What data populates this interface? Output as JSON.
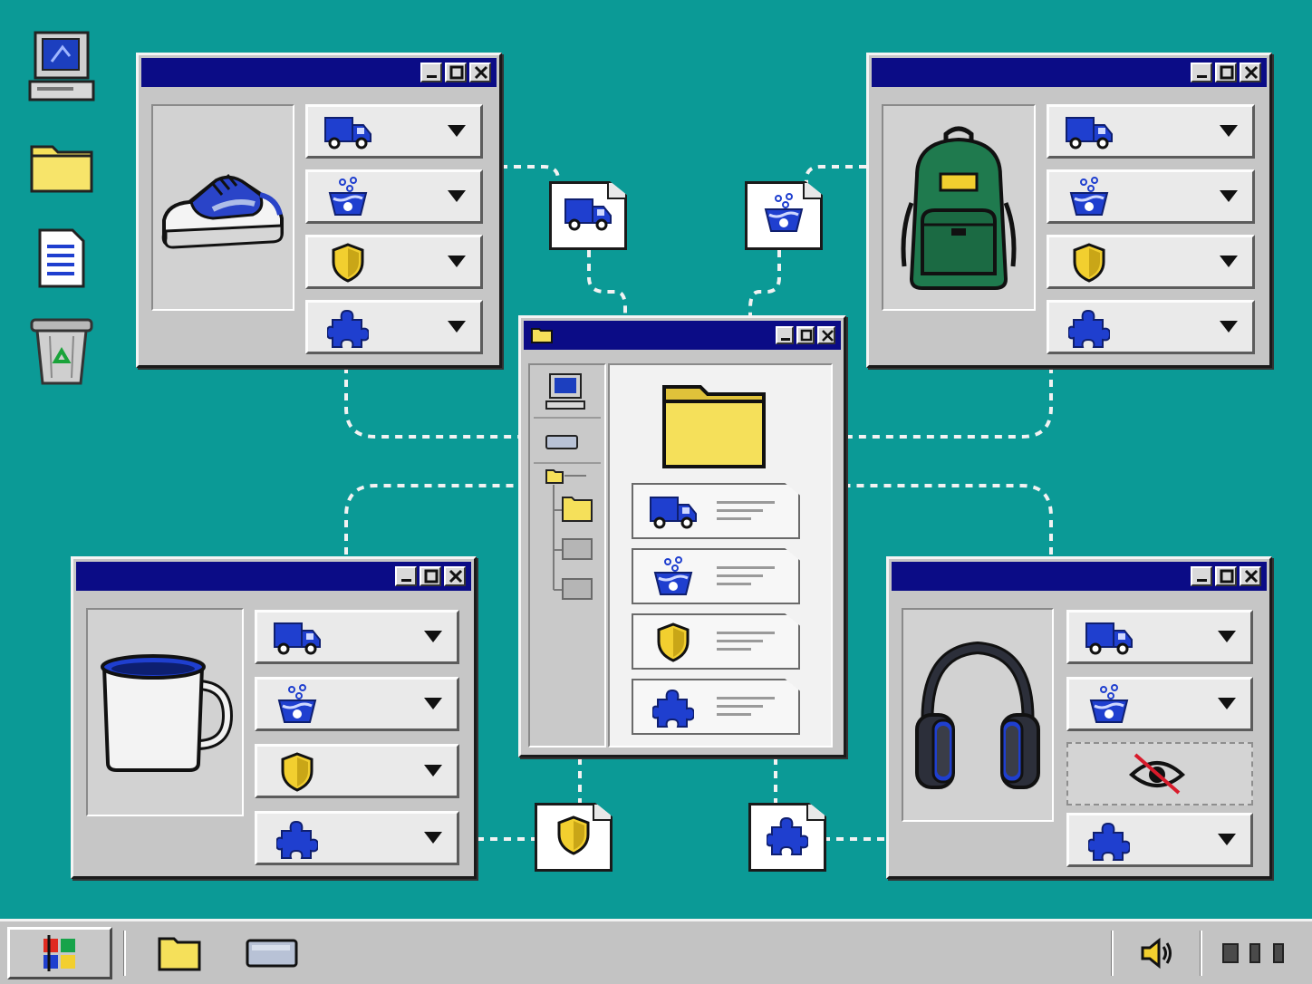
{
  "colors": {
    "desktop": "#0b9a96",
    "titlebar": "#0b0c86",
    "window_face": "#c6c6c6",
    "icon_blue": "#1f3fcf",
    "folder_yellow": "#f5e05a",
    "shield_yellow": "#f2cf2f"
  },
  "desktop_icons": [
    "computer-icon",
    "folder-icon",
    "document-icon",
    "recycle-bin-icon"
  ],
  "option_icons": [
    "delivery-truck-icon",
    "washing-basin-icon",
    "shield-icon",
    "puzzle-piece-icon"
  ],
  "windows": [
    {
      "id": "sneaker-window",
      "product_icon": "sneaker-icon",
      "dropdowns": [
        "delivery-truck-icon",
        "washing-basin-icon",
        "shield-icon",
        "puzzle-piece-icon"
      ]
    },
    {
      "id": "backpack-window",
      "product_icon": "backpack-icon",
      "dropdowns": [
        "delivery-truck-icon",
        "washing-basin-icon",
        "shield-icon",
        "puzzle-piece-icon"
      ]
    },
    {
      "id": "mug-window",
      "product_icon": "mug-icon",
      "dropdowns": [
        "delivery-truck-icon",
        "washing-basin-icon",
        "shield-icon",
        "puzzle-piece-icon"
      ]
    },
    {
      "id": "headphones-window",
      "product_icon": "headphones-icon",
      "dropdowns": [
        "delivery-truck-icon",
        "washing-basin-icon",
        "hidden-eye-icon",
        "puzzle-piece-icon"
      ],
      "hidden_option": "shield-icon"
    }
  ],
  "center_window": {
    "title_icon": "folder-icon",
    "tree": [
      "computer-icon",
      "drive-icon",
      "folder-icon",
      "folder-icon",
      "folder-icon",
      "folder-icon"
    ],
    "documents": [
      "delivery-truck-icon",
      "washing-basin-icon",
      "shield-icon",
      "puzzle-piece-icon"
    ]
  },
  "floating_cards": [
    "delivery-truck-icon",
    "washing-basin-icon",
    "shield-icon",
    "puzzle-piece-icon"
  ],
  "taskbar": {
    "items": [
      "start-logo-icon",
      "folder-icon",
      "drive-icon"
    ],
    "tray": [
      "speaker-icon",
      "tray-indicators-icon"
    ]
  }
}
